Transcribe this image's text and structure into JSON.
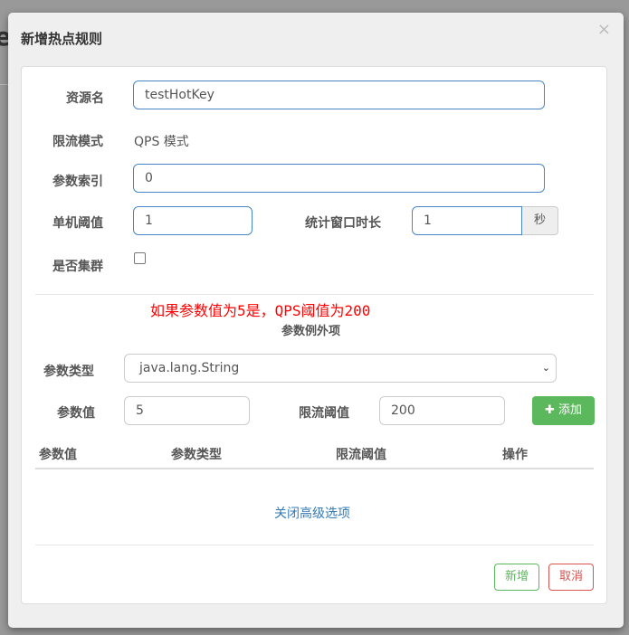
{
  "background": {
    "partial_letter": "e"
  },
  "dialog": {
    "title": "新增热点规则",
    "close": "×"
  },
  "form": {
    "resource_label": "资源名",
    "resource_value": "testHotKey",
    "mode_label": "限流模式",
    "mode_value": "QPS 模式",
    "param_index_label": "参数索引",
    "param_index_value": "0",
    "threshold_label": "单机阈值",
    "threshold_value": "1",
    "window_label": "统计窗口时长",
    "window_value": "1",
    "window_unit": "秒",
    "cluster_label": "是否集群"
  },
  "annotation": "如果参数值为5是，QPS阈值为200",
  "exceptions": {
    "title": "参数例外项",
    "type_label": "参数类型",
    "type_value": "java.lang.String",
    "value_label": "参数值",
    "value_value": "5",
    "limit_label": "限流阈值",
    "limit_value": "200",
    "add_label": "添加",
    "columns": [
      "参数值",
      "参数类型",
      "限流阈值",
      "操作"
    ]
  },
  "advanced_link": "关闭高级选项",
  "footer": {
    "add": "新增",
    "cancel": "取消"
  },
  "colors": {
    "accent": "#4a86c5",
    "success": "#5cb85c",
    "danger": "#d9534f",
    "annotation": "#ff0000"
  }
}
